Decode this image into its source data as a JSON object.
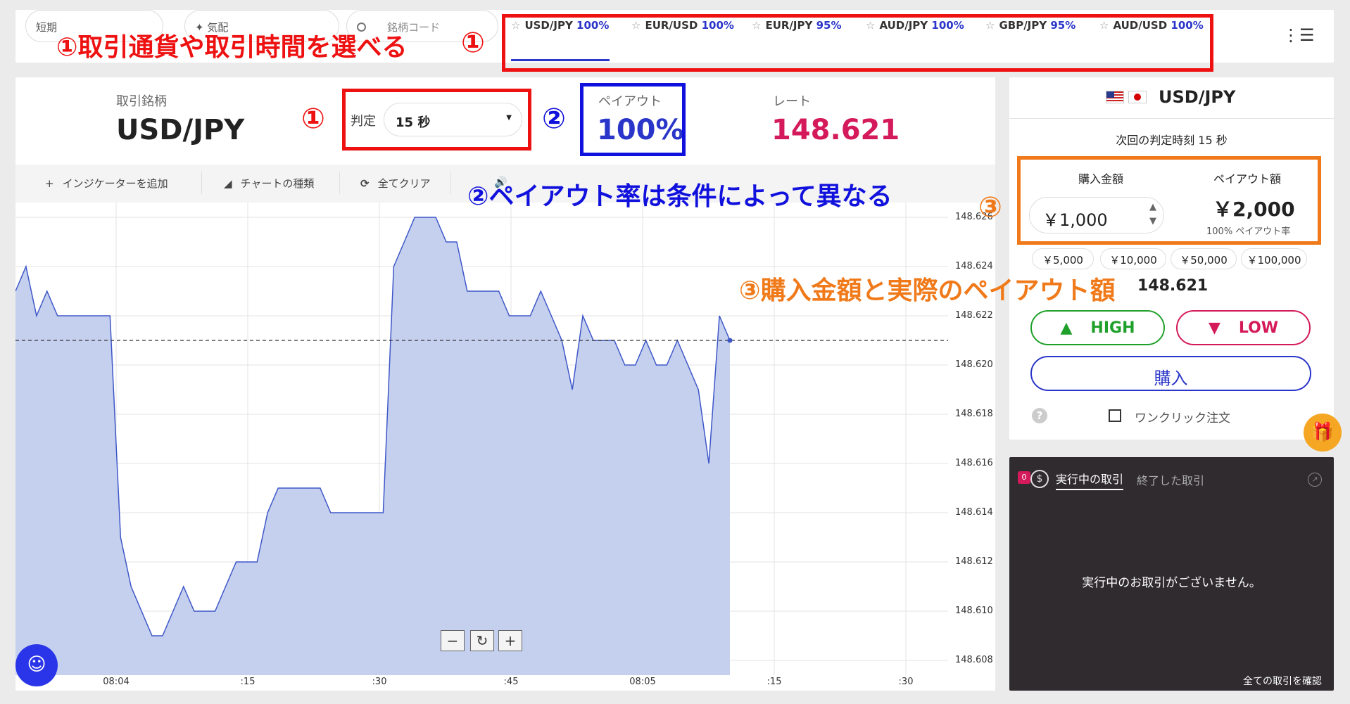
{
  "filters": {
    "pill_1": "短期",
    "pill_2": "✦ 気配",
    "pill_3_icon": "search-icon",
    "pill_3_placeholder": "銘柄コード"
  },
  "tabs": [
    {
      "pair": "USD/JPY",
      "pct": "100%"
    },
    {
      "pair": "EUR/USD",
      "pct": "100%"
    },
    {
      "pair": "EUR/JPY",
      "pct": "95%"
    },
    {
      "pair": "AUD/JPY",
      "pct": "100%"
    },
    {
      "pair": "GBP/JPY",
      "pct": "95%"
    },
    {
      "pair": "AUD/USD",
      "pct": "100%"
    }
  ],
  "menu_glyph": "⋮☰",
  "info": {
    "symbol_label": "取引銘柄",
    "symbol": "USD/JPY",
    "judge_label": "判定",
    "judge_value": "15 秒",
    "payout_label": "ペイアウト",
    "payout_value": "100%",
    "rate_label": "レート",
    "rate_value": "148.621"
  },
  "toolbar": {
    "add_indicator": "インジケーターを追加",
    "chart_type": "チャートの種類",
    "clear_all": "全てクリア"
  },
  "chart_data": {
    "type": "area",
    "y_ticks": [
      "148.626",
      "148.624",
      "148.622",
      "148.620",
      "148.618",
      "148.616",
      "148.614",
      "148.612",
      "148.610",
      "148.608"
    ],
    "x_ticks": [
      "08:04",
      ":15",
      ":30",
      ":45",
      "08:05",
      ":15",
      ":30"
    ],
    "ylim": [
      148.6074,
      148.6266
    ],
    "current_value": 148.621,
    "series": [
      {
        "x": [
          0,
          1,
          2,
          3,
          4,
          5,
          6,
          7,
          8,
          9,
          10,
          11,
          12,
          13,
          14,
          15,
          16,
          17,
          18,
          19,
          20,
          21,
          22,
          23,
          24,
          25,
          26,
          27,
          28,
          29,
          30,
          31,
          32,
          33,
          34,
          35,
          36,
          37,
          38,
          39,
          40,
          41,
          42,
          43,
          44,
          45,
          46,
          47,
          48,
          49,
          50,
          51,
          52,
          53,
          54,
          55,
          56,
          57,
          58,
          59,
          60,
          61,
          62,
          63,
          64,
          65,
          66,
          67,
          68
        ],
        "y": [
          148.623,
          148.624,
          148.622,
          148.623,
          148.622,
          148.622,
          148.622,
          148.622,
          148.622,
          148.622,
          148.613,
          148.611,
          148.61,
          148.609,
          148.609,
          148.61,
          148.611,
          148.61,
          148.61,
          148.61,
          148.611,
          148.612,
          148.612,
          148.612,
          148.614,
          148.615,
          148.615,
          148.615,
          148.615,
          148.615,
          148.614,
          148.614,
          148.614,
          148.614,
          148.614,
          148.614,
          148.624,
          148.625,
          148.626,
          148.626,
          148.626,
          148.625,
          148.625,
          148.623,
          148.623,
          148.623,
          148.623,
          148.622,
          148.622,
          148.622,
          148.623,
          148.622,
          148.621,
          148.619,
          148.622,
          148.621,
          148.621,
          148.621,
          148.62,
          148.62,
          148.621,
          148.62,
          148.62,
          148.621,
          148.62,
          148.619,
          148.616,
          148.622,
          148.621
        ]
      }
    ]
  },
  "zoom": {
    "minus": "−",
    "reset": "↻",
    "plus": "+"
  },
  "panel": {
    "pair": "USD/JPY",
    "next_judge": "次回の判定時刻 15 秒",
    "amount_label": "購入金額",
    "amount_value": "￥1,000",
    "payout_label": "ペイアウト額",
    "payout_value": "￥2,000",
    "payout_rate": "100% ペイアウト率",
    "quick_amounts": [
      "￥5,000",
      "￥10,000",
      "￥50,000",
      "￥100,000"
    ],
    "rate": "148.621",
    "high": "HIGH",
    "low": "LOW",
    "buy": "購入",
    "one_click": "ワンクリック注文"
  },
  "trades": {
    "badge": "0",
    "active_tab": "実行中の取引",
    "ended_tab": "終了した取引",
    "empty": "実行中のお取引がございません。",
    "all_link": "全ての取引を確認"
  },
  "annotations": {
    "a1_top": "①取引通貨や取引時間を選べる",
    "a1_circle": "①",
    "a1_judge": "①",
    "a2_circle": "②",
    "a2_text": "②ペイアウト率は条件によって異なる",
    "a3_circle": "③",
    "a3_text": "③購入金額と実際のペイアウト額",
    "red": "#ee1111",
    "blue": "#1111dd",
    "orange": "#f07a1a"
  },
  "colors": {
    "high_green": "#1fa02a",
    "low_pink": "#d41a5a",
    "brand_blue": "#2a35c9",
    "chart_fill": "#c5d0ef",
    "chart_line": "#3e57c8",
    "dark_panel": "#2f2b2f"
  }
}
